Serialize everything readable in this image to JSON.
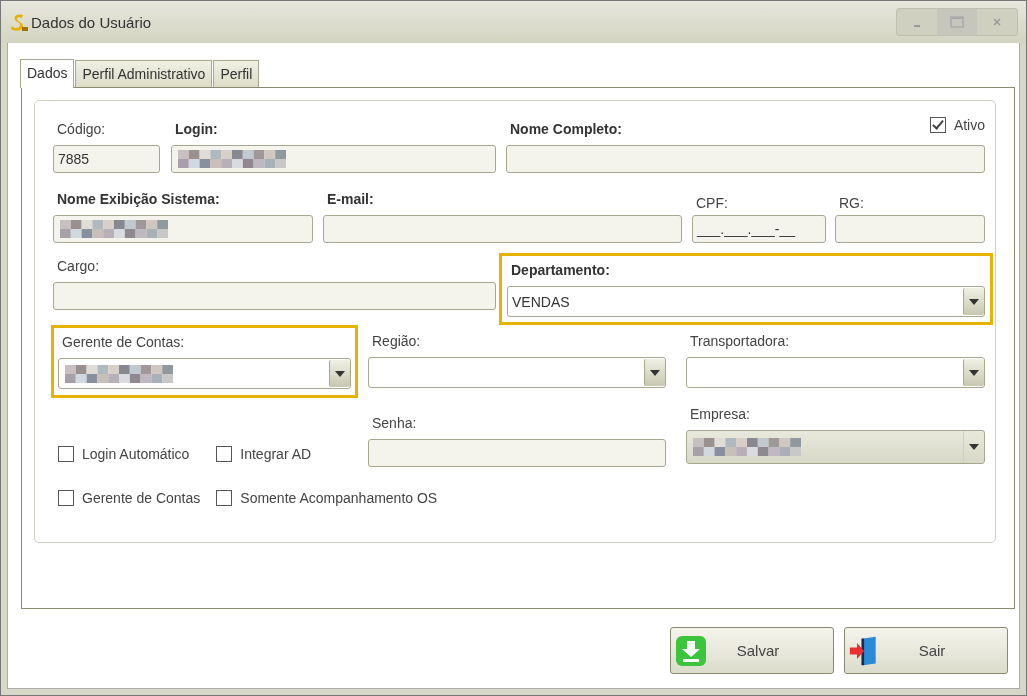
{
  "window": {
    "title": "Dados do Usuário"
  },
  "tabs": [
    {
      "label": "Dados",
      "selected": true
    },
    {
      "label": "Perfil Administrativo",
      "selected": false
    },
    {
      "label": "Perfil",
      "selected": false
    }
  ],
  "ativo": {
    "label": "Ativo",
    "checked": true
  },
  "fields": [
    {
      "label": "Código:",
      "bold": false,
      "kind": "text",
      "value": "7885"
    },
    {
      "label": "Login:",
      "bold": true,
      "kind": "text",
      "blurred": true
    },
    {
      "label": "Nome Completo:",
      "bold": true,
      "kind": "text"
    },
    {
      "label": "Nome Exibição Sistema:",
      "bold": true,
      "kind": "text",
      "blurred": true
    },
    {
      "label": "E-mail:",
      "bold": true,
      "kind": "text"
    },
    {
      "label": "CPF:",
      "bold": false,
      "kind": "text",
      "value": "___.___.___-__"
    },
    {
      "label": "RG:",
      "bold": false,
      "kind": "text"
    },
    {
      "label": "Cargo:",
      "bold": false,
      "kind": "text"
    },
    {
      "label": "Departamento:",
      "bold": true,
      "kind": "combo",
      "value": "VENDAS",
      "highlighted": true
    },
    {
      "label": "Gerente de Contas:",
      "bold": false,
      "kind": "combo",
      "blurred": true,
      "highlighted": true
    },
    {
      "label": "Região:",
      "bold": false,
      "kind": "combo"
    },
    {
      "label": "Transportadora:",
      "bold": false,
      "kind": "combo"
    },
    {
      "label": "Senha:",
      "bold": false,
      "kind": "text"
    },
    {
      "label": "Empresa:",
      "bold": false,
      "kind": "combo",
      "blurred": true,
      "disabled": true
    }
  ],
  "checkboxes": [
    {
      "label": "Login Automático",
      "checked": false
    },
    {
      "label": "Integrar AD",
      "checked": false
    },
    {
      "label": "Gerente de Contas",
      "checked": false
    },
    {
      "label": "Somente Acompanhamento OS",
      "checked": false
    }
  ],
  "buttons": [
    {
      "label": "Salvar",
      "kind": "save"
    },
    {
      "label": "Sair",
      "kind": "exit"
    }
  ]
}
